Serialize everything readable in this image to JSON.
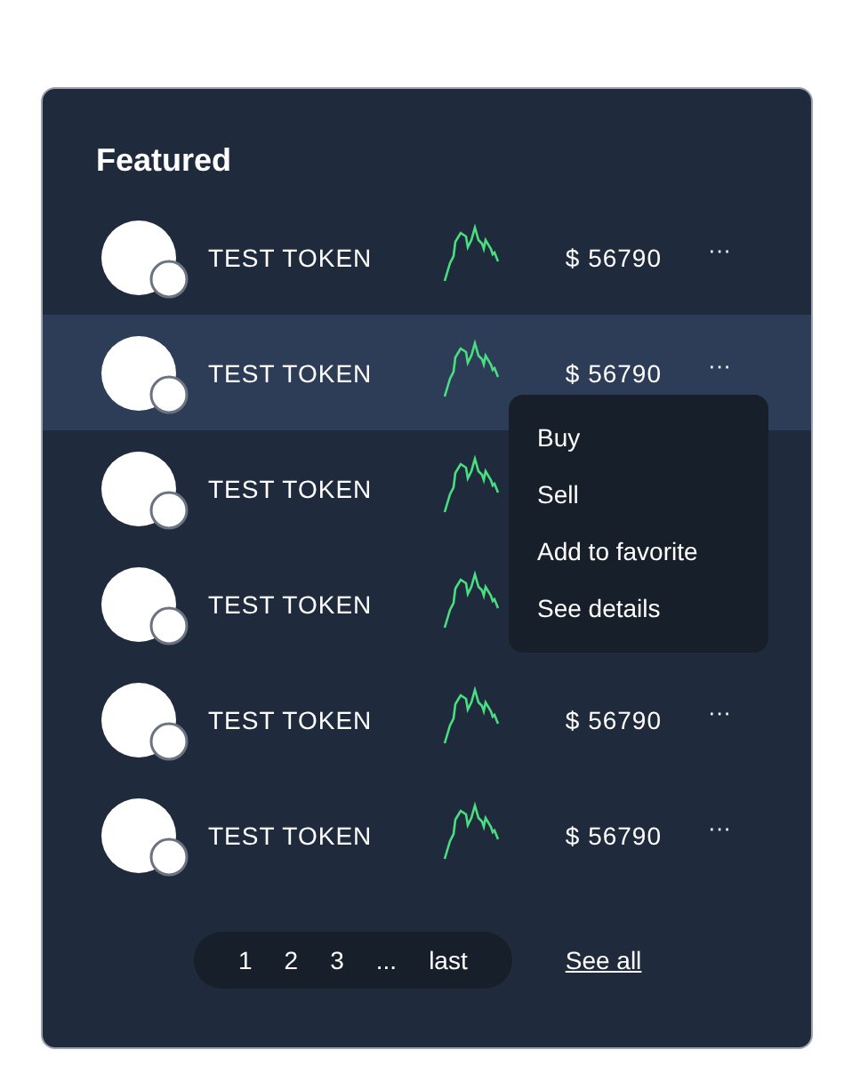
{
  "title": "Featured",
  "tokens": [
    {
      "name": "TEST TOKEN",
      "price": "$ 56790",
      "more": "···",
      "selected": false
    },
    {
      "name": "TEST TOKEN",
      "price": "$ 56790",
      "more": "···",
      "selected": true
    },
    {
      "name": "TEST TOKEN",
      "selected": false
    },
    {
      "name": "TEST TOKEN",
      "selected": false
    },
    {
      "name": "TEST TOKEN",
      "price": "$ 56790",
      "more": "···",
      "selected": false
    },
    {
      "name": "TEST TOKEN",
      "price": "$ 56790",
      "more": "···",
      "selected": false
    }
  ],
  "menu": {
    "items": [
      "Buy",
      "Sell",
      "Add to favorite",
      "See details"
    ]
  },
  "pagination": [
    "1",
    "2",
    "3",
    "...",
    "last"
  ],
  "see_all": "See all"
}
